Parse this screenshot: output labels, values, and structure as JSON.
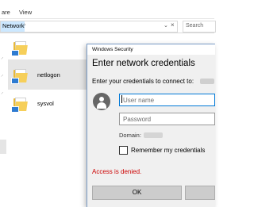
{
  "ribbon": {
    "tabs": [
      "are",
      "View"
    ]
  },
  "address": {
    "path": "Network",
    "separator": "›",
    "search_placeholder": "Search"
  },
  "files": [
    {
      "name": ""
    },
    {
      "name": "netlogon"
    },
    {
      "name": "sysvol"
    }
  ],
  "dialog": {
    "title": "Windows Security",
    "heading": "Enter network credentials",
    "prompt": "Enter your credentials to connect to:",
    "username_placeholder": "User name",
    "password_placeholder": "Password",
    "domain_label": "Domain:",
    "remember_label": "Remember my credentials",
    "error": "Access is denied.",
    "ok_label": "OK",
    "cancel_label": ""
  },
  "icons": {
    "folder": "folder-icon",
    "avatar": "user-avatar-icon",
    "pin": "pin-icon",
    "dropdown": "chevron-down-icon",
    "close": "close-icon"
  },
  "colors": {
    "accent": "#0078d7",
    "error": "#cc0000",
    "selection": "#cce8ff"
  }
}
